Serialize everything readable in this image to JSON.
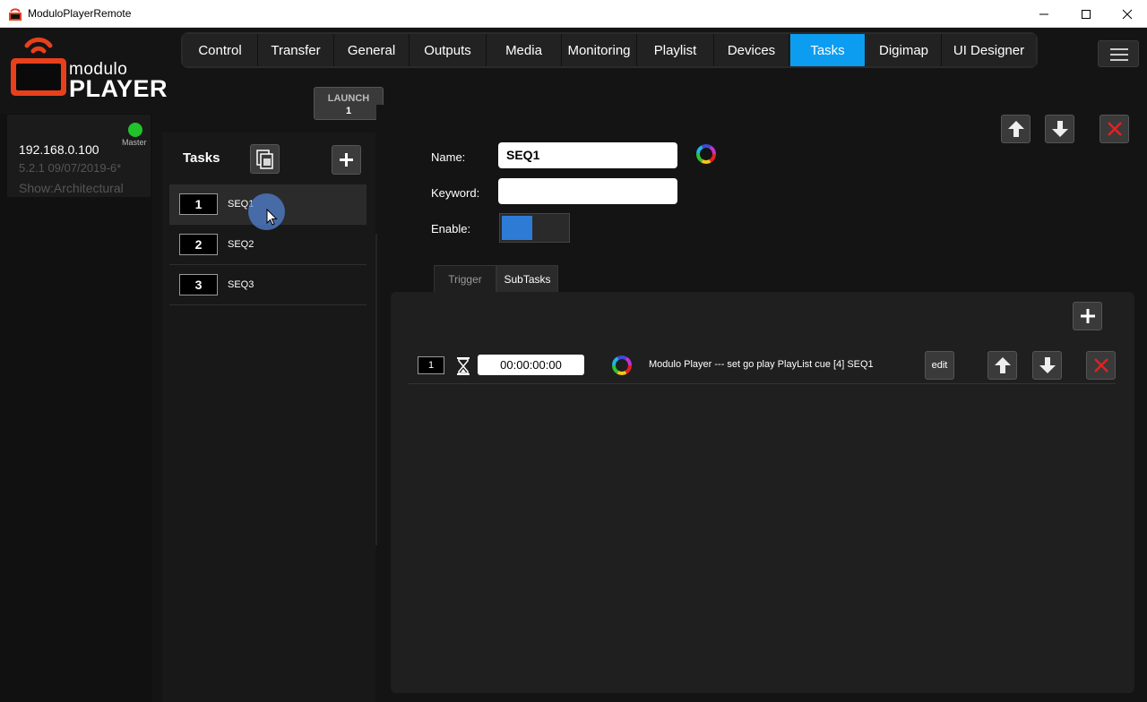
{
  "window": {
    "title": "ModuloPlayerRemote"
  },
  "logo": {
    "word1": "modulo",
    "word2": "PLAYER"
  },
  "nav": {
    "tabs": [
      "Control",
      "Transfer",
      "General",
      "Outputs",
      "Media",
      "Monitoring",
      "Playlist",
      "Devices",
      "Tasks",
      "Digimap",
      "UI Designer"
    ],
    "active": "Tasks",
    "active_color": "#0c9df0"
  },
  "launch": {
    "label": "LAUNCH",
    "count": "1"
  },
  "server": {
    "ip": "192.168.0.100",
    "version": "5.2.1 09/07/2019-6*",
    "show": "Show:Architectural",
    "role": "Master",
    "status_color": "#22c22a"
  },
  "tasks": {
    "title": "Tasks",
    "items": [
      {
        "num": "1",
        "name": "SEQ1"
      },
      {
        "num": "2",
        "name": "SEQ2"
      },
      {
        "num": "3",
        "name": "SEQ3"
      }
    ]
  },
  "detail": {
    "name_label": "Name:",
    "name_value": "SEQ1",
    "keyword_label": "Keyword:",
    "keyword_value": "",
    "enable_label": "Enable:",
    "enabled": true
  },
  "subtabs": {
    "trigger": "Trigger",
    "subtasks": "SubTasks",
    "active": "SubTasks"
  },
  "subtasks": [
    {
      "num": "1",
      "time": "00:00:00:00",
      "description": "Modulo Player --- set go play PlayList cue [4]  SEQ1",
      "edit_label": "edit"
    }
  ]
}
